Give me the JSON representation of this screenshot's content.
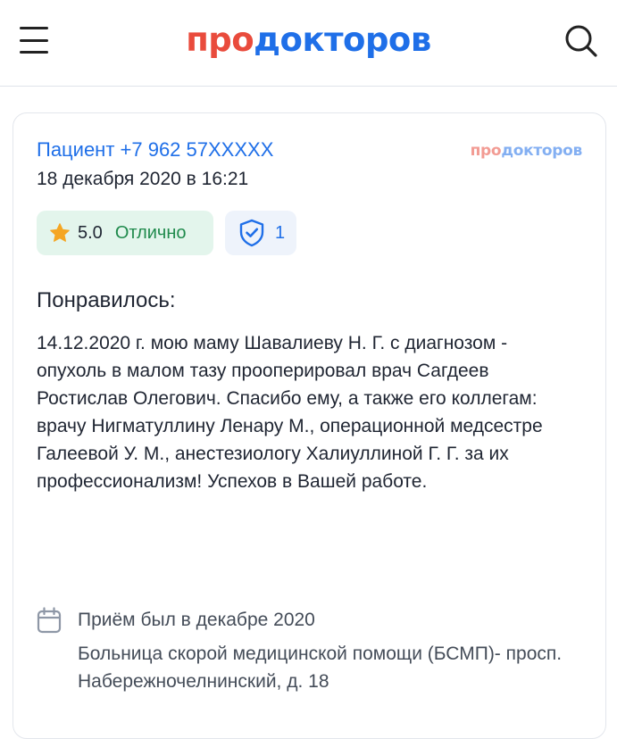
{
  "header": {
    "logo_part1": "про",
    "logo_part2": "докторов",
    "menu_icon": "hamburger-menu-icon",
    "search_icon": "search-icon"
  },
  "review": {
    "author": "Пациент +7 962 57XXXXX",
    "date": "18 декабря 2020 в 16:21",
    "source_logo_part1": "про",
    "source_logo_part2": "докторов",
    "rating": {
      "score": "5.0",
      "label": "Отлично",
      "icon": "star-icon"
    },
    "verification": {
      "count": "1",
      "icon": "shield-check-icon"
    },
    "liked_title": "Понравилось:",
    "liked_text": "14.12.2020 г. мою маму Шавалиеву Н. Г. с диагнозом - опухоль в малом тазу прооперировал врач Сагдеев Ростислав Олегович. Спасибо ему, а также его коллегам: врачу Нигматуллину Ленару М., операционной медсестре Галеевой У. М., анестезиологу Халиуллиной Г. Г. за их профессионализм! Успехов в Вашей работе.",
    "visit": {
      "when": "Приём был в декабре 2020",
      "place": "Больница скорой медицинской помощи (БСМП)- просп. Набережночелнинский, д. 18",
      "icon": "calendar-icon"
    }
  },
  "colors": {
    "brand_red": "#e94b3c",
    "brand_blue": "#1f6fe8",
    "rating_bg": "#e3f5ec",
    "rating_label": "#1f8a4c",
    "star": "#f5a623"
  }
}
